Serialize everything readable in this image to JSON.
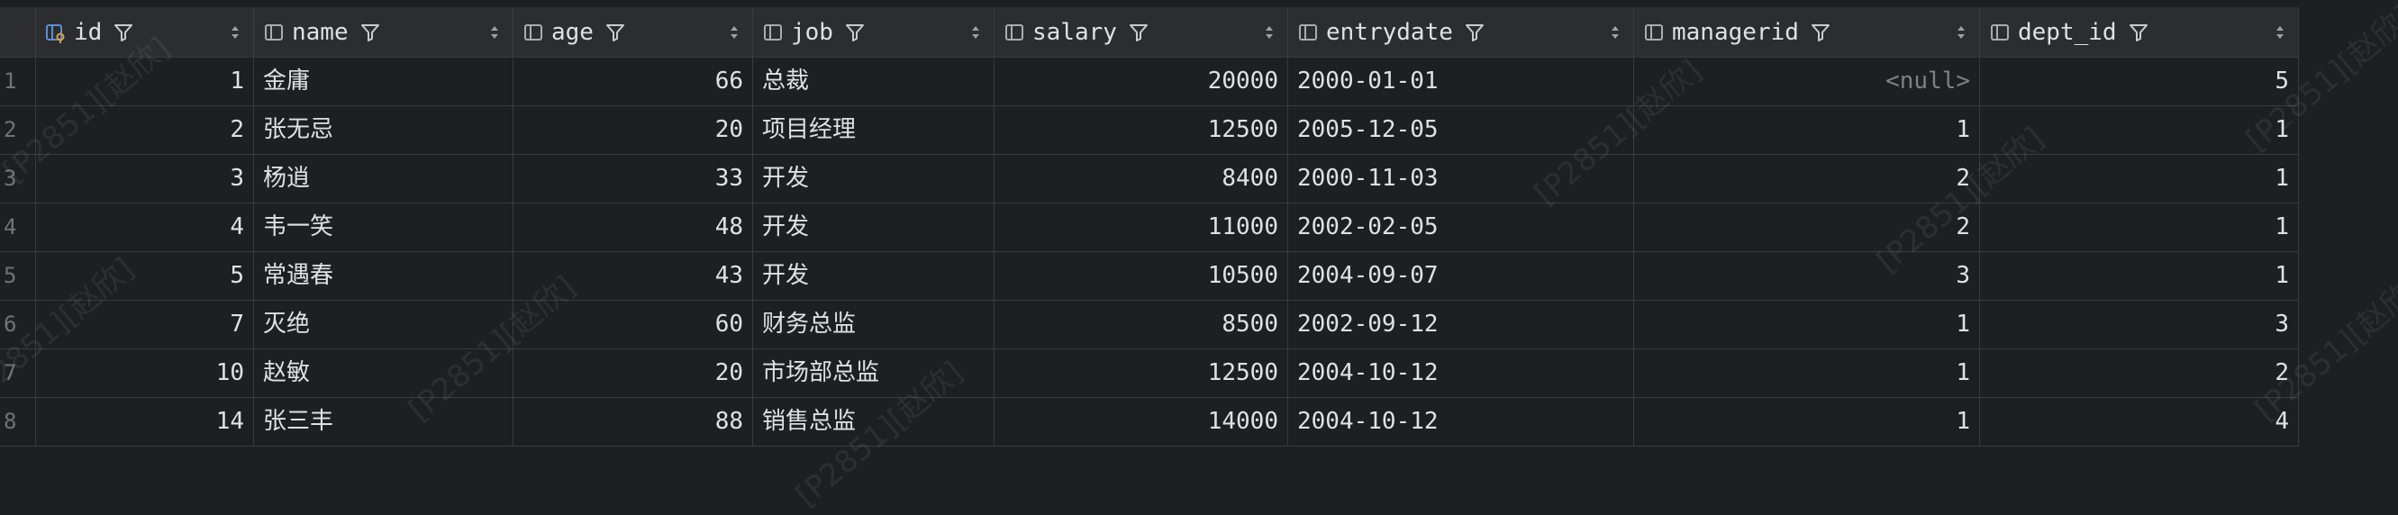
{
  "columns": [
    {
      "key": "id",
      "label": "id",
      "icon": "primary-key-icon"
    },
    {
      "key": "name",
      "label": "name",
      "icon": "column-icon"
    },
    {
      "key": "age",
      "label": "age",
      "icon": "column-icon"
    },
    {
      "key": "job",
      "label": "job",
      "icon": "column-icon"
    },
    {
      "key": "salary",
      "label": "salary",
      "icon": "column-icon"
    },
    {
      "key": "entrydate",
      "label": "entrydate",
      "icon": "column-icon"
    },
    {
      "key": "managerid",
      "label": "managerid",
      "icon": "column-icon"
    },
    {
      "key": "dept_id",
      "label": "dept_id",
      "icon": "column-icon"
    }
  ],
  "rows": [
    {
      "num": "1",
      "id": "1",
      "name": "金庸",
      "age": "66",
      "job": "总裁",
      "salary": "20000",
      "entrydate": "2000-01-01",
      "managerid": "<null>",
      "dept_id": "5"
    },
    {
      "num": "2",
      "id": "2",
      "name": "张无忌",
      "age": "20",
      "job": "项目经理",
      "salary": "12500",
      "entrydate": "2005-12-05",
      "managerid": "1",
      "dept_id": "1"
    },
    {
      "num": "3",
      "id": "3",
      "name": "杨逍",
      "age": "33",
      "job": "开发",
      "salary": "8400",
      "entrydate": "2000-11-03",
      "managerid": "2",
      "dept_id": "1"
    },
    {
      "num": "4",
      "id": "4",
      "name": "韦一笑",
      "age": "48",
      "job": "开发",
      "salary": "11000",
      "entrydate": "2002-02-05",
      "managerid": "2",
      "dept_id": "1"
    },
    {
      "num": "5",
      "id": "5",
      "name": "常遇春",
      "age": "43",
      "job": "开发",
      "salary": "10500",
      "entrydate": "2004-09-07",
      "managerid": "3",
      "dept_id": "1"
    },
    {
      "num": "6",
      "id": "7",
      "name": "灭绝",
      "age": "60",
      "job": "财务总监",
      "salary": "8500",
      "entrydate": "2002-09-12",
      "managerid": "1",
      "dept_id": "3"
    },
    {
      "num": "7",
      "id": "10",
      "name": "赵敏",
      "age": "20",
      "job": "市场部总监",
      "salary": "12500",
      "entrydate": "2004-10-12",
      "managerid": "1",
      "dept_id": "2"
    },
    {
      "num": "8",
      "id": "14",
      "name": "张三丰",
      "age": "88",
      "job": "销售总监",
      "salary": "14000",
      "entrydate": "2004-10-12",
      "managerid": "1",
      "dept_id": "4"
    }
  ],
  "watermark": {
    "text": "[P2851][赵欣]"
  },
  "colors": {
    "background": "#1e1f22",
    "header": "#2b2d30",
    "grid": "#393b40",
    "pk_icon": "#5f8dd3",
    "pk_key": "#d9a343"
  }
}
